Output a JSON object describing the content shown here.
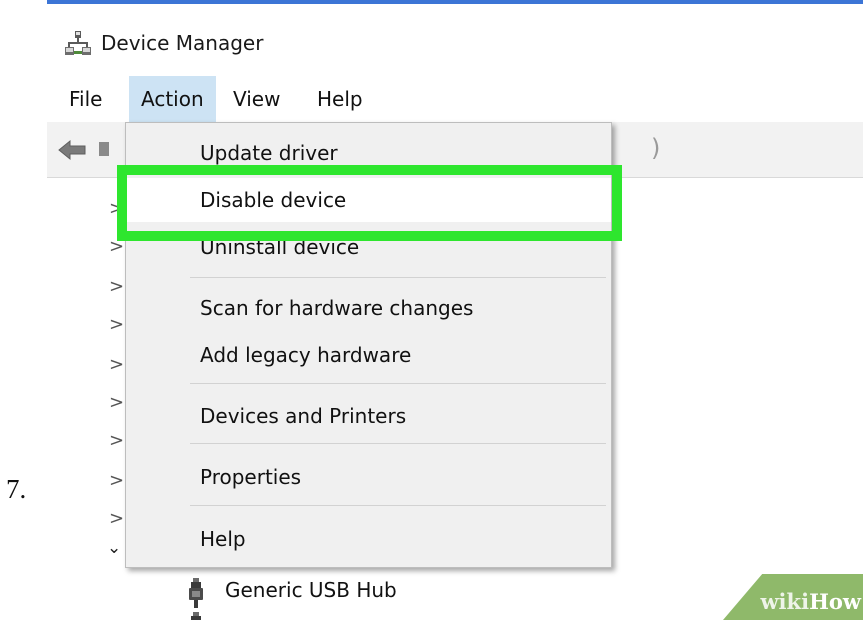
{
  "step": {
    "number": "7."
  },
  "window": {
    "title": "Device Manager"
  },
  "menubar": {
    "items": [
      {
        "label": "File"
      },
      {
        "label": "Action"
      },
      {
        "label": "View"
      },
      {
        "label": "Help"
      }
    ],
    "active": "Action"
  },
  "toolbar": {
    "back_icon": "back-arrow-icon",
    "trailing_text": ")"
  },
  "tree": {
    "collapsed_glyph": ">",
    "expanded_glyph": "⌄",
    "visible_child": {
      "label": "Generic USB Hub",
      "icon": "usb-icon"
    }
  },
  "action_menu": {
    "items": [
      {
        "label": "Update driver"
      },
      {
        "label": "Disable device"
      },
      {
        "label": "Uninstall device"
      },
      {
        "label": "Scan for hardware changes"
      },
      {
        "label": "Add legacy hardware"
      },
      {
        "label": "Devices and Printers"
      },
      {
        "label": "Properties"
      },
      {
        "label": "Help"
      }
    ],
    "highlighted_item": "Disable device"
  },
  "annotation": {
    "highlight_color": "#2ee62e"
  },
  "watermark": {
    "part1": "wiki",
    "part2": "How"
  },
  "colors": {
    "menu_active_bg": "#cde3f4",
    "dropdown_bg": "#f0f0f0",
    "window_top_border": "#3c75d6",
    "watermark_bg": "#8fb96a"
  }
}
